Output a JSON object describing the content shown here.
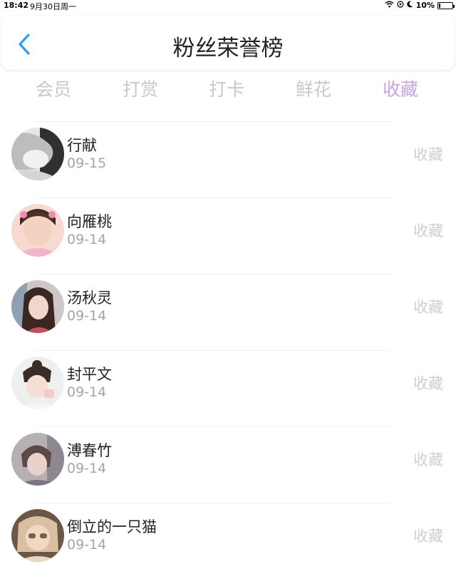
{
  "status_bar": {
    "time": "18:42",
    "date": "9月30日周一",
    "battery_percent": "10%",
    "battery_level": 0.1,
    "icons": [
      "wifi-icon",
      "location-icon",
      "moon-icon",
      "battery-icon"
    ]
  },
  "header": {
    "title": "粉丝荣誉榜",
    "back_icon": "chevron-left-icon",
    "accent": "#2e9cf5"
  },
  "tabs": [
    {
      "label": "会员",
      "active": false
    },
    {
      "label": "打赏",
      "active": false
    },
    {
      "label": "打卡",
      "active": false
    },
    {
      "label": "鲜花",
      "active": false
    },
    {
      "label": "收藏",
      "active": true
    }
  ],
  "active_color": "#c8a3e6",
  "fans": [
    {
      "name": "行献",
      "date": "09-15",
      "action": "收藏"
    },
    {
      "name": "向雁桃",
      "date": "09-14",
      "action": "收藏"
    },
    {
      "name": "汤秋灵",
      "date": "09-14",
      "action": "收藏"
    },
    {
      "name": "封平文",
      "date": "09-14",
      "action": "收藏"
    },
    {
      "name": "溥春竹",
      "date": "09-14",
      "action": "收藏"
    },
    {
      "name": "倒立的一只猫",
      "date": "09-14",
      "action": "收藏"
    }
  ]
}
